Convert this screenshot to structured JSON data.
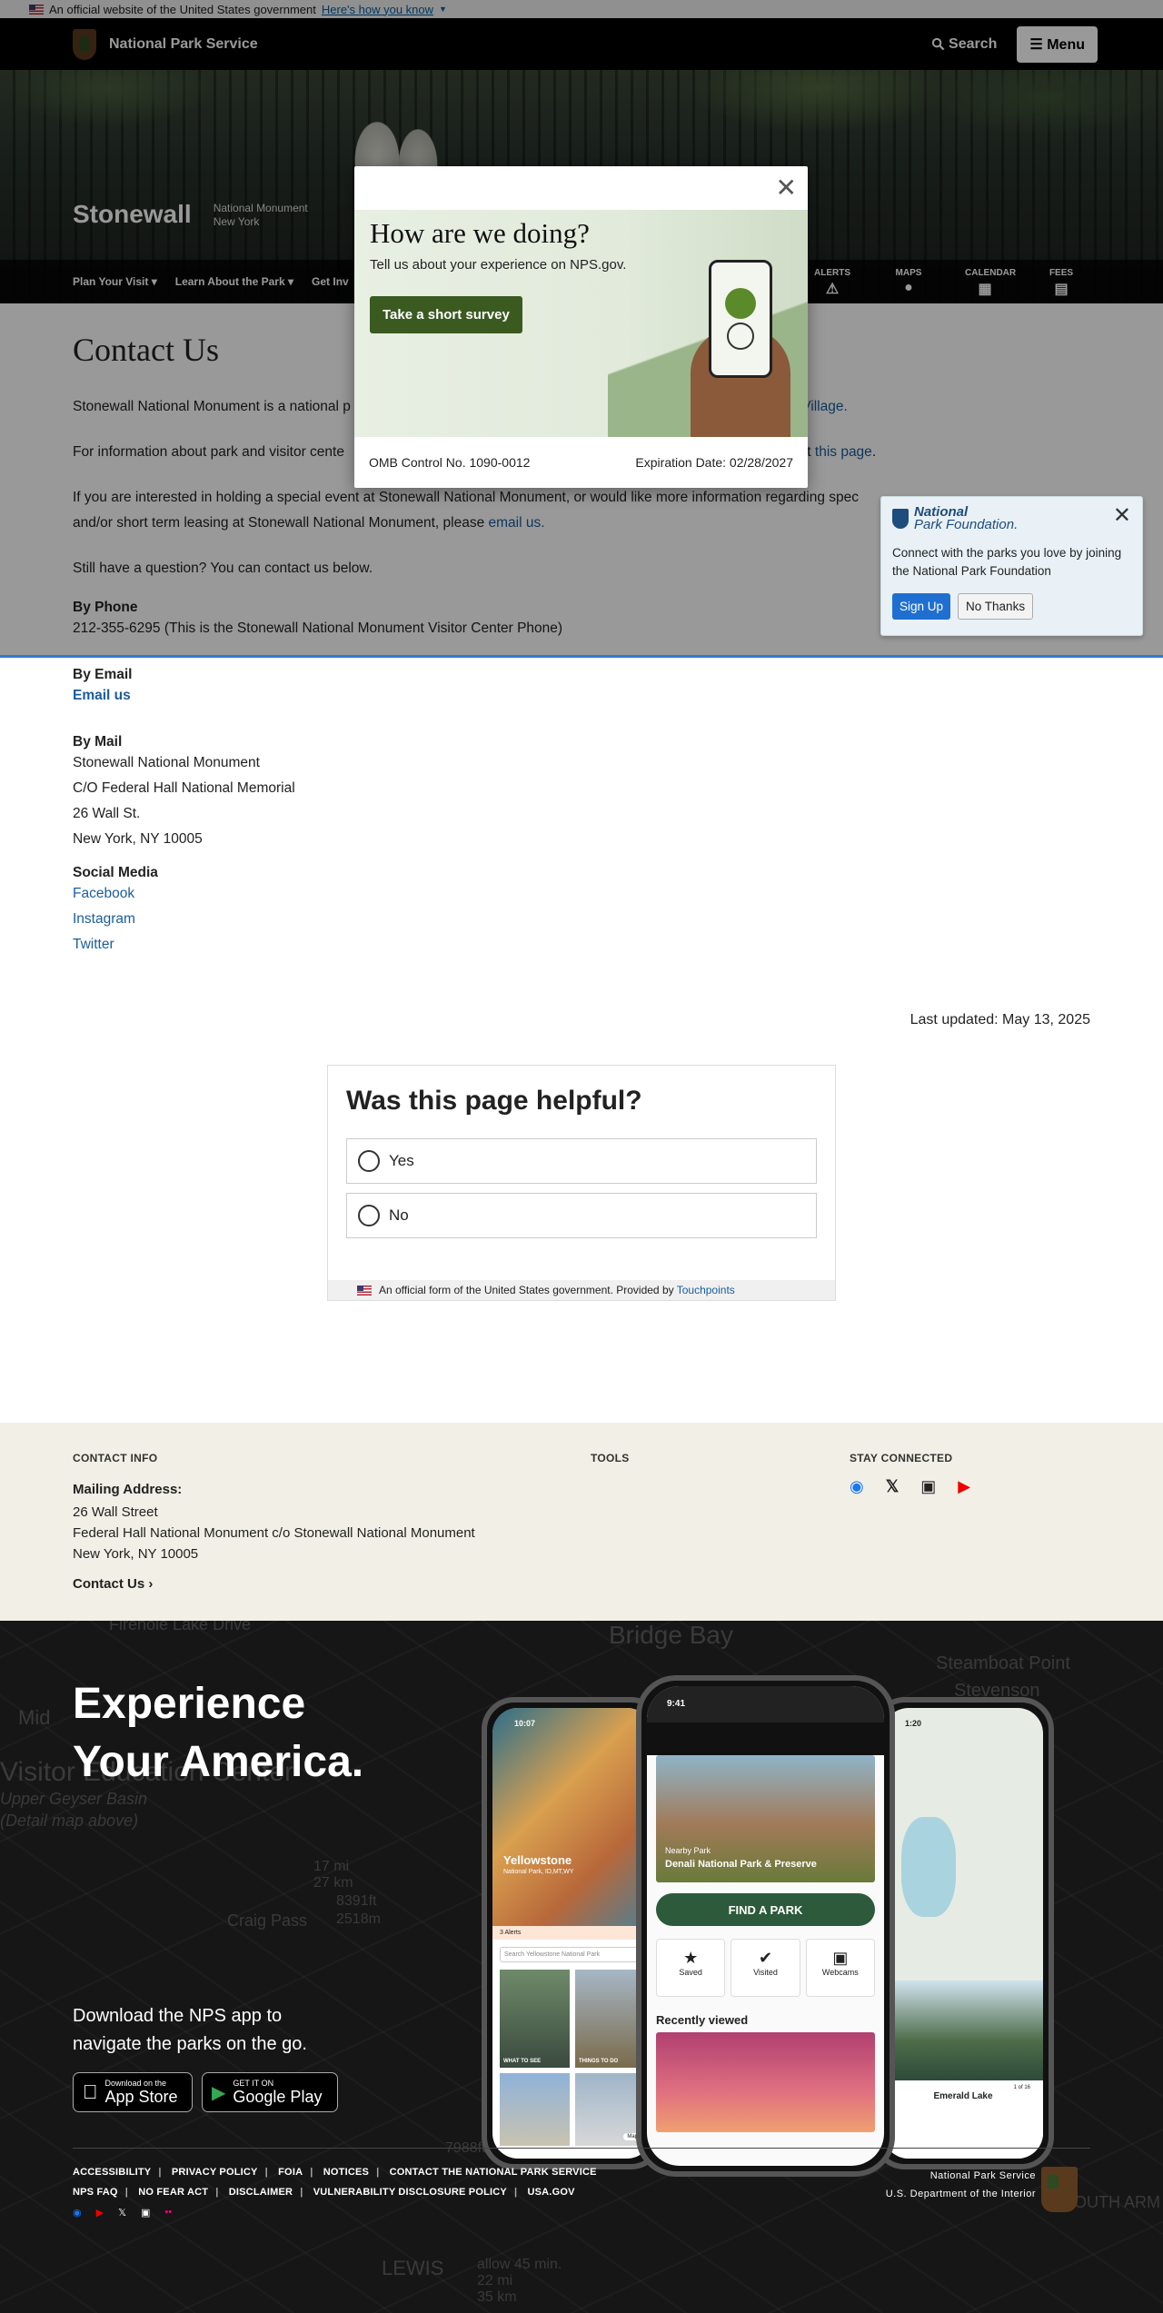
{
  "gov_banner": {
    "text": "An official website of the United States government",
    "link": "Here's how you know"
  },
  "header": {
    "agency": "National Park Service",
    "search": "Search",
    "menu": "Menu"
  },
  "park": {
    "name": "Stonewall",
    "designation": "National Monument",
    "state": "New York",
    "nav": [
      "Plan Your Visit",
      "Learn About the Park",
      "Get Inv"
    ],
    "tools": [
      "ALERTS",
      "MAPS",
      "CALENDAR",
      "FEES"
    ]
  },
  "main": {
    "title": "Contact Us",
    "p1_a": "Stonewall National Monument is a national p",
    "p1_link": "reenwich Village.",
    "p2_a": "For information about park and visitor cente",
    "p2_b": "k out ",
    "p2_link": "this page",
    "p2_end": ".",
    "p3": "If you are interested in holding a special event at Stonewall National Monument, or would like more information regarding spec",
    "p3_b": "and/or short term leasing at Stonewall National Monument, please ",
    "p3_link": "email us.",
    "p4": "Still have a question? You can contact us below.",
    "phone_h": "By Phone",
    "phone": "212-355-6295 (This is the Stonewall National Monument Visitor Center Phone)",
    "email_h": "By Email",
    "email": "Email us",
    "mail_h": "By Mail",
    "mail": [
      "Stonewall National Monument",
      "C/O Federal Hall National Memorial",
      "26 Wall St.",
      "New York, NY 10005"
    ],
    "social_h": "Social Media",
    "social": [
      "Facebook",
      "Instagram",
      "Twitter"
    ],
    "last_updated": "Last updated: May 13, 2025"
  },
  "helpful": {
    "title": "Was this page helpful?",
    "yes": "Yes",
    "no": "No",
    "footer": "An official form of the United States government. Provided by ",
    "footer_link": "Touchpoints"
  },
  "footer": {
    "contact_h": "CONTACT INFO",
    "mailing_h": "Mailing Address:",
    "addr": [
      "26 Wall Street",
      "Federal Hall National Monument c/o Stonewall National Monument",
      "New York, NY 10005"
    ],
    "contact_link": "Contact Us",
    "tools_h": "TOOLS",
    "stay_h": "STAY CONNECTED"
  },
  "experience": {
    "title1": "Experience",
    "title2": "Your America.",
    "sub1": "Download the NPS app to",
    "sub2": "navigate the parks on the go.",
    "appstore_small": "Download on the",
    "appstore_big": "App Store",
    "google_small": "GET IT ON",
    "google_big": "Google Play",
    "map_labels": [
      "Bridge Bay",
      "Steamboat Point",
      "Stevenson",
      "Visitor Education Center",
      "Upper Geyser Basin",
      "Firehole Lake Drive",
      "Craig Pass",
      "LEWIS",
      "allow 45 min.",
      "SOUTH ARM",
      "Mid",
      "(Detail map above)",
      "8391ft",
      "2518m",
      "17 mi",
      "27 km",
      "7988ft",
      "22 mi",
      "35 km"
    ],
    "phone_left": {
      "time": "10:07",
      "park": "Yellowstone",
      "sub": "National Park, ID,MT,WY",
      "search": "Search Yellowstone National Park",
      "tile1": "WHAT TO SEE",
      "tile2": "THINGS TO DO",
      "alerts": "3 Alerts",
      "map": "Map"
    },
    "phone_center": {
      "time": "9:41",
      "nearby": "Nearby Park",
      "park": "Denali National Park & Preserve",
      "find": "FIND A PARK",
      "saved": "Saved",
      "visited": "Visited",
      "webcams": "Webcams",
      "recent": "Recently viewed"
    },
    "phone_right": {
      "time": "1:20",
      "lake": "Emerald Lake",
      "pager": "1 of 16"
    }
  },
  "legal": {
    "row1": [
      "ACCESSIBILITY",
      "PRIVACY POLICY",
      "FOIA",
      "NOTICES",
      "CONTACT THE NATIONAL PARK SERVICE"
    ],
    "row2": [
      "NPS FAQ",
      "NO FEAR ACT",
      "DISCLAIMER",
      "VULNERABILITY DISCLOSURE POLICY",
      "USA.GOV"
    ],
    "agency": "National Park Service",
    "dept": "U.S. Department of the Interior"
  },
  "survey": {
    "title": "How are we doing?",
    "text": "Tell us about your experience on NPS.gov.",
    "button": "Take a short survey",
    "omb": "OMB Control No. 1090-0012",
    "expires": "Expiration Date: 02/28/2027"
  },
  "npf": {
    "logo1": "National",
    "logo2": "Park Foundation.",
    "text": "Connect with the parks you love by joining the National Park Foundation",
    "signup": "Sign Up",
    "no": "No Thanks"
  }
}
